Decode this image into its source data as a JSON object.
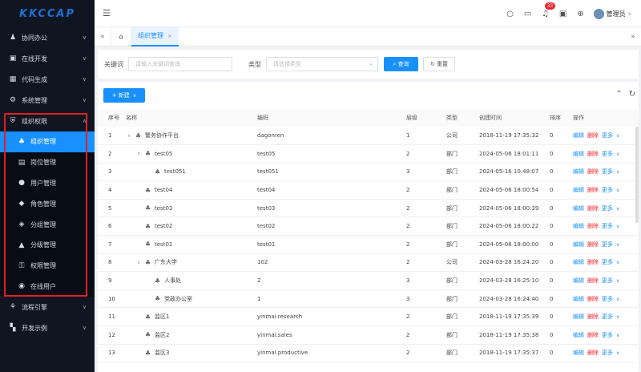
{
  "logo": {
    "text": "KKCCAP"
  },
  "sidebar": {
    "top_items": [
      {
        "label": "协同办公",
        "icon": "users-icon"
      },
      {
        "label": "在线开发",
        "icon": "image-icon"
      },
      {
        "label": "代码生成",
        "icon": "calendar-icon"
      },
      {
        "label": "系统管理",
        "icon": "gear-icon"
      }
    ],
    "group": {
      "label": "组织权限",
      "icon": "shield-icon"
    },
    "sub_items": [
      {
        "label": "组织管理",
        "icon": "org-icon",
        "active": true
      },
      {
        "label": "岗位管理",
        "icon": "id-card-icon"
      },
      {
        "label": "用户管理",
        "icon": "user-icon"
      },
      {
        "label": "角色管理",
        "icon": "role-icon"
      },
      {
        "label": "分组管理",
        "icon": "group-icon"
      },
      {
        "label": "分级管理",
        "icon": "level-icon"
      },
      {
        "label": "权限管理",
        "icon": "key-icon"
      },
      {
        "label": "在线用户",
        "icon": "online-user-icon"
      }
    ],
    "bottom_items": [
      {
        "label": "流程引擎",
        "icon": "flow-icon"
      },
      {
        "label": "开发示例",
        "icon": "apps-icon"
      }
    ]
  },
  "header": {
    "badge": "33",
    "user": "管理员"
  },
  "tabs": [
    {
      "label": "组织管理",
      "active": true
    }
  ],
  "filter": {
    "keyword_label": "关键词",
    "keyword_placeholder": "请输入关键词查询",
    "type_label": "类型",
    "type_placeholder": "请选择类型",
    "search_label": "查询",
    "reset_label": "重置"
  },
  "toolbar": {
    "new_label": "新建"
  },
  "table": {
    "headers": [
      "序号",
      "名称",
      "编码",
      "层级",
      "类型",
      "创建时间",
      "排序",
      "操作"
    ],
    "ops": {
      "edit": "编辑",
      "delete": "删除",
      "more": "更多"
    },
    "rows": [
      {
        "idx": "1",
        "name": "警务协作平台",
        "code": "dagonren",
        "level": "1",
        "type": "公司",
        "time": "2018-11-19 17:35:32",
        "sort": "0",
        "indent": 0,
        "expand": true
      },
      {
        "idx": "2",
        "name": "test05",
        "code": "test05",
        "level": "2",
        "type": "部门",
        "time": "2024-05-06 18:01:11",
        "sort": "0",
        "indent": 1,
        "expand": true
      },
      {
        "idx": "3",
        "name": "test051",
        "code": "test051",
        "level": "3",
        "type": "部门",
        "time": "2024-05-16 10:48:07",
        "sort": "0",
        "indent": 2,
        "expand": false
      },
      {
        "idx": "4",
        "name": "test04",
        "code": "test04",
        "level": "2",
        "type": "部门",
        "time": "2024-05-06 18:00:54",
        "sort": "0",
        "indent": 1,
        "expand": false
      },
      {
        "idx": "5",
        "name": "test03",
        "code": "test03",
        "level": "2",
        "type": "部门",
        "time": "2024-05-06 18:00:39",
        "sort": "0",
        "indent": 1,
        "expand": false
      },
      {
        "idx": "6",
        "name": "test02",
        "code": "test02",
        "level": "2",
        "type": "部门",
        "time": "2024-05-06 18:00:22",
        "sort": "0",
        "indent": 1,
        "expand": false
      },
      {
        "idx": "7",
        "name": "test01",
        "code": "test01",
        "level": "2",
        "type": "部门",
        "time": "2024-05-06 18:00:00",
        "sort": "0",
        "indent": 1,
        "expand": false
      },
      {
        "idx": "8",
        "name": "广东大学",
        "code": "102",
        "level": "2",
        "type": "公司",
        "time": "2024-03-28 16:24:20",
        "sort": "0",
        "indent": 1,
        "expand": true
      },
      {
        "idx": "9",
        "name": "人事处",
        "code": "2",
        "level": "3",
        "type": "部门",
        "time": "2024-03-28 16:25:10",
        "sort": "0",
        "indent": 2,
        "expand": false
      },
      {
        "idx": "10",
        "name": "党政办公室",
        "code": "1",
        "level": "3",
        "type": "部门",
        "time": "2024-03-28 16:24:40",
        "sort": "0",
        "indent": 2,
        "expand": false
      },
      {
        "idx": "11",
        "name": "监区1",
        "code": "yinmai.research",
        "level": "2",
        "type": "部门",
        "time": "2018-11-19 17:35:39",
        "sort": "0",
        "indent": 1,
        "expand": false
      },
      {
        "idx": "12",
        "name": "监区2",
        "code": "yinmai.sales",
        "level": "2",
        "type": "部门",
        "time": "2018-11-19 17:35:38",
        "sort": "0",
        "indent": 1,
        "expand": false
      },
      {
        "idx": "13",
        "name": "监区3",
        "code": "yinmai.productive",
        "level": "2",
        "type": "部门",
        "time": "2018-11-19 17:35:37",
        "sort": "0",
        "indent": 1,
        "expand": false
      }
    ]
  }
}
